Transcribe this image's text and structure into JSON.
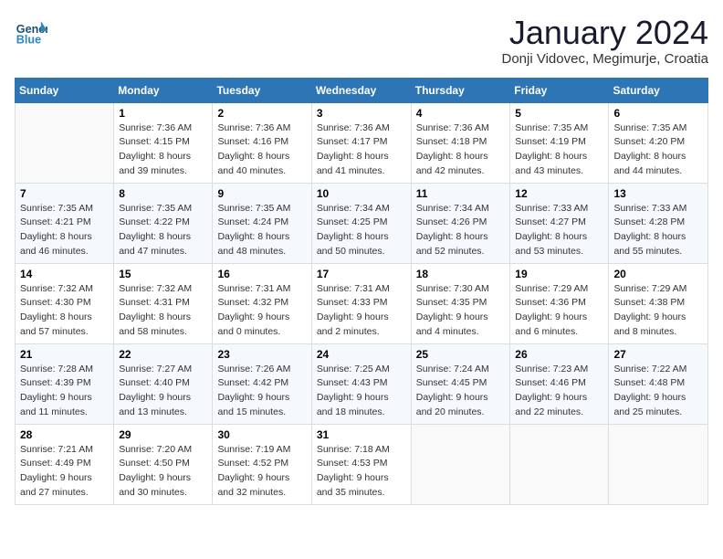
{
  "logo": {
    "line1": "General",
    "line2": "Blue"
  },
  "title": "January 2024",
  "subtitle": "Donji Vidovec, Megimurje, Croatia",
  "days_header": [
    "Sunday",
    "Monday",
    "Tuesday",
    "Wednesday",
    "Thursday",
    "Friday",
    "Saturday"
  ],
  "weeks": [
    [
      {
        "day": "",
        "sunrise": "",
        "sunset": "",
        "daylight": ""
      },
      {
        "day": "1",
        "sunrise": "Sunrise: 7:36 AM",
        "sunset": "Sunset: 4:15 PM",
        "daylight": "Daylight: 8 hours and 39 minutes."
      },
      {
        "day": "2",
        "sunrise": "Sunrise: 7:36 AM",
        "sunset": "Sunset: 4:16 PM",
        "daylight": "Daylight: 8 hours and 40 minutes."
      },
      {
        "day": "3",
        "sunrise": "Sunrise: 7:36 AM",
        "sunset": "Sunset: 4:17 PM",
        "daylight": "Daylight: 8 hours and 41 minutes."
      },
      {
        "day": "4",
        "sunrise": "Sunrise: 7:36 AM",
        "sunset": "Sunset: 4:18 PM",
        "daylight": "Daylight: 8 hours and 42 minutes."
      },
      {
        "day": "5",
        "sunrise": "Sunrise: 7:35 AM",
        "sunset": "Sunset: 4:19 PM",
        "daylight": "Daylight: 8 hours and 43 minutes."
      },
      {
        "day": "6",
        "sunrise": "Sunrise: 7:35 AM",
        "sunset": "Sunset: 4:20 PM",
        "daylight": "Daylight: 8 hours and 44 minutes."
      }
    ],
    [
      {
        "day": "7",
        "sunrise": "Sunrise: 7:35 AM",
        "sunset": "Sunset: 4:21 PM",
        "daylight": "Daylight: 8 hours and 46 minutes."
      },
      {
        "day": "8",
        "sunrise": "Sunrise: 7:35 AM",
        "sunset": "Sunset: 4:22 PM",
        "daylight": "Daylight: 8 hours and 47 minutes."
      },
      {
        "day": "9",
        "sunrise": "Sunrise: 7:35 AM",
        "sunset": "Sunset: 4:24 PM",
        "daylight": "Daylight: 8 hours and 48 minutes."
      },
      {
        "day": "10",
        "sunrise": "Sunrise: 7:34 AM",
        "sunset": "Sunset: 4:25 PM",
        "daylight": "Daylight: 8 hours and 50 minutes."
      },
      {
        "day": "11",
        "sunrise": "Sunrise: 7:34 AM",
        "sunset": "Sunset: 4:26 PM",
        "daylight": "Daylight: 8 hours and 52 minutes."
      },
      {
        "day": "12",
        "sunrise": "Sunrise: 7:33 AM",
        "sunset": "Sunset: 4:27 PM",
        "daylight": "Daylight: 8 hours and 53 minutes."
      },
      {
        "day": "13",
        "sunrise": "Sunrise: 7:33 AM",
        "sunset": "Sunset: 4:28 PM",
        "daylight": "Daylight: 8 hours and 55 minutes."
      }
    ],
    [
      {
        "day": "14",
        "sunrise": "Sunrise: 7:32 AM",
        "sunset": "Sunset: 4:30 PM",
        "daylight": "Daylight: 8 hours and 57 minutes."
      },
      {
        "day": "15",
        "sunrise": "Sunrise: 7:32 AM",
        "sunset": "Sunset: 4:31 PM",
        "daylight": "Daylight: 8 hours and 58 minutes."
      },
      {
        "day": "16",
        "sunrise": "Sunrise: 7:31 AM",
        "sunset": "Sunset: 4:32 PM",
        "daylight": "Daylight: 9 hours and 0 minutes."
      },
      {
        "day": "17",
        "sunrise": "Sunrise: 7:31 AM",
        "sunset": "Sunset: 4:33 PM",
        "daylight": "Daylight: 9 hours and 2 minutes."
      },
      {
        "day": "18",
        "sunrise": "Sunrise: 7:30 AM",
        "sunset": "Sunset: 4:35 PM",
        "daylight": "Daylight: 9 hours and 4 minutes."
      },
      {
        "day": "19",
        "sunrise": "Sunrise: 7:29 AM",
        "sunset": "Sunset: 4:36 PM",
        "daylight": "Daylight: 9 hours and 6 minutes."
      },
      {
        "day": "20",
        "sunrise": "Sunrise: 7:29 AM",
        "sunset": "Sunset: 4:38 PM",
        "daylight": "Daylight: 9 hours and 8 minutes."
      }
    ],
    [
      {
        "day": "21",
        "sunrise": "Sunrise: 7:28 AM",
        "sunset": "Sunset: 4:39 PM",
        "daylight": "Daylight: 9 hours and 11 minutes."
      },
      {
        "day": "22",
        "sunrise": "Sunrise: 7:27 AM",
        "sunset": "Sunset: 4:40 PM",
        "daylight": "Daylight: 9 hours and 13 minutes."
      },
      {
        "day": "23",
        "sunrise": "Sunrise: 7:26 AM",
        "sunset": "Sunset: 4:42 PM",
        "daylight": "Daylight: 9 hours and 15 minutes."
      },
      {
        "day": "24",
        "sunrise": "Sunrise: 7:25 AM",
        "sunset": "Sunset: 4:43 PM",
        "daylight": "Daylight: 9 hours and 18 minutes."
      },
      {
        "day": "25",
        "sunrise": "Sunrise: 7:24 AM",
        "sunset": "Sunset: 4:45 PM",
        "daylight": "Daylight: 9 hours and 20 minutes."
      },
      {
        "day": "26",
        "sunrise": "Sunrise: 7:23 AM",
        "sunset": "Sunset: 4:46 PM",
        "daylight": "Daylight: 9 hours and 22 minutes."
      },
      {
        "day": "27",
        "sunrise": "Sunrise: 7:22 AM",
        "sunset": "Sunset: 4:48 PM",
        "daylight": "Daylight: 9 hours and 25 minutes."
      }
    ],
    [
      {
        "day": "28",
        "sunrise": "Sunrise: 7:21 AM",
        "sunset": "Sunset: 4:49 PM",
        "daylight": "Daylight: 9 hours and 27 minutes."
      },
      {
        "day": "29",
        "sunrise": "Sunrise: 7:20 AM",
        "sunset": "Sunset: 4:50 PM",
        "daylight": "Daylight: 9 hours and 30 minutes."
      },
      {
        "day": "30",
        "sunrise": "Sunrise: 7:19 AM",
        "sunset": "Sunset: 4:52 PM",
        "daylight": "Daylight: 9 hours and 32 minutes."
      },
      {
        "day": "31",
        "sunrise": "Sunrise: 7:18 AM",
        "sunset": "Sunset: 4:53 PM",
        "daylight": "Daylight: 9 hours and 35 minutes."
      },
      {
        "day": "",
        "sunrise": "",
        "sunset": "",
        "daylight": ""
      },
      {
        "day": "",
        "sunrise": "",
        "sunset": "",
        "daylight": ""
      },
      {
        "day": "",
        "sunrise": "",
        "sunset": "",
        "daylight": ""
      }
    ]
  ]
}
